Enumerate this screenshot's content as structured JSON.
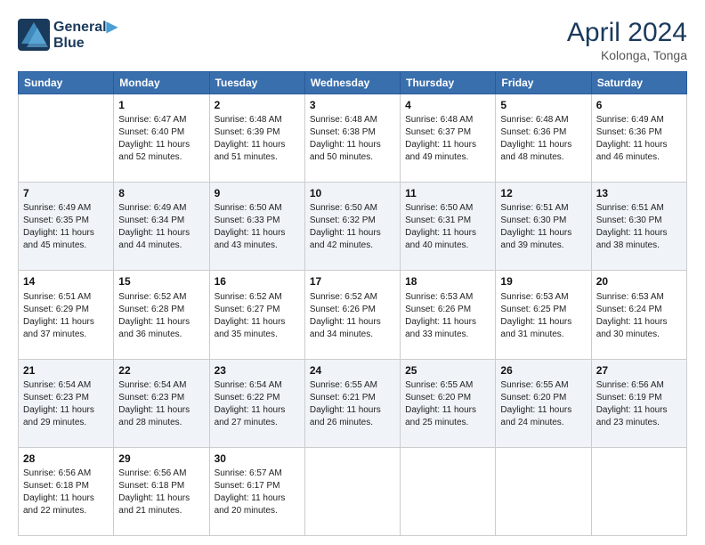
{
  "header": {
    "logo_line1": "General",
    "logo_line2": "Blue",
    "month_year": "April 2024",
    "location": "Kolonga, Tonga"
  },
  "weekdays": [
    "Sunday",
    "Monday",
    "Tuesday",
    "Wednesday",
    "Thursday",
    "Friday",
    "Saturday"
  ],
  "weeks": [
    [
      {
        "day": "",
        "info": ""
      },
      {
        "day": "1",
        "info": "Sunrise: 6:47 AM\nSunset: 6:40 PM\nDaylight: 11 hours\nand 52 minutes."
      },
      {
        "day": "2",
        "info": "Sunrise: 6:48 AM\nSunset: 6:39 PM\nDaylight: 11 hours\nand 51 minutes."
      },
      {
        "day": "3",
        "info": "Sunrise: 6:48 AM\nSunset: 6:38 PM\nDaylight: 11 hours\nand 50 minutes."
      },
      {
        "day": "4",
        "info": "Sunrise: 6:48 AM\nSunset: 6:37 PM\nDaylight: 11 hours\nand 49 minutes."
      },
      {
        "day": "5",
        "info": "Sunrise: 6:48 AM\nSunset: 6:36 PM\nDaylight: 11 hours\nand 48 minutes."
      },
      {
        "day": "6",
        "info": "Sunrise: 6:49 AM\nSunset: 6:36 PM\nDaylight: 11 hours\nand 46 minutes."
      }
    ],
    [
      {
        "day": "7",
        "info": "Sunrise: 6:49 AM\nSunset: 6:35 PM\nDaylight: 11 hours\nand 45 minutes."
      },
      {
        "day": "8",
        "info": "Sunrise: 6:49 AM\nSunset: 6:34 PM\nDaylight: 11 hours\nand 44 minutes."
      },
      {
        "day": "9",
        "info": "Sunrise: 6:50 AM\nSunset: 6:33 PM\nDaylight: 11 hours\nand 43 minutes."
      },
      {
        "day": "10",
        "info": "Sunrise: 6:50 AM\nSunset: 6:32 PM\nDaylight: 11 hours\nand 42 minutes."
      },
      {
        "day": "11",
        "info": "Sunrise: 6:50 AM\nSunset: 6:31 PM\nDaylight: 11 hours\nand 40 minutes."
      },
      {
        "day": "12",
        "info": "Sunrise: 6:51 AM\nSunset: 6:30 PM\nDaylight: 11 hours\nand 39 minutes."
      },
      {
        "day": "13",
        "info": "Sunrise: 6:51 AM\nSunset: 6:30 PM\nDaylight: 11 hours\nand 38 minutes."
      }
    ],
    [
      {
        "day": "14",
        "info": "Sunrise: 6:51 AM\nSunset: 6:29 PM\nDaylight: 11 hours\nand 37 minutes."
      },
      {
        "day": "15",
        "info": "Sunrise: 6:52 AM\nSunset: 6:28 PM\nDaylight: 11 hours\nand 36 minutes."
      },
      {
        "day": "16",
        "info": "Sunrise: 6:52 AM\nSunset: 6:27 PM\nDaylight: 11 hours\nand 35 minutes."
      },
      {
        "day": "17",
        "info": "Sunrise: 6:52 AM\nSunset: 6:26 PM\nDaylight: 11 hours\nand 34 minutes."
      },
      {
        "day": "18",
        "info": "Sunrise: 6:53 AM\nSunset: 6:26 PM\nDaylight: 11 hours\nand 33 minutes."
      },
      {
        "day": "19",
        "info": "Sunrise: 6:53 AM\nSunset: 6:25 PM\nDaylight: 11 hours\nand 31 minutes."
      },
      {
        "day": "20",
        "info": "Sunrise: 6:53 AM\nSunset: 6:24 PM\nDaylight: 11 hours\nand 30 minutes."
      }
    ],
    [
      {
        "day": "21",
        "info": "Sunrise: 6:54 AM\nSunset: 6:23 PM\nDaylight: 11 hours\nand 29 minutes."
      },
      {
        "day": "22",
        "info": "Sunrise: 6:54 AM\nSunset: 6:23 PM\nDaylight: 11 hours\nand 28 minutes."
      },
      {
        "day": "23",
        "info": "Sunrise: 6:54 AM\nSunset: 6:22 PM\nDaylight: 11 hours\nand 27 minutes."
      },
      {
        "day": "24",
        "info": "Sunrise: 6:55 AM\nSunset: 6:21 PM\nDaylight: 11 hours\nand 26 minutes."
      },
      {
        "day": "25",
        "info": "Sunrise: 6:55 AM\nSunset: 6:20 PM\nDaylight: 11 hours\nand 25 minutes."
      },
      {
        "day": "26",
        "info": "Sunrise: 6:55 AM\nSunset: 6:20 PM\nDaylight: 11 hours\nand 24 minutes."
      },
      {
        "day": "27",
        "info": "Sunrise: 6:56 AM\nSunset: 6:19 PM\nDaylight: 11 hours\nand 23 minutes."
      }
    ],
    [
      {
        "day": "28",
        "info": "Sunrise: 6:56 AM\nSunset: 6:18 PM\nDaylight: 11 hours\nand 22 minutes."
      },
      {
        "day": "29",
        "info": "Sunrise: 6:56 AM\nSunset: 6:18 PM\nDaylight: 11 hours\nand 21 minutes."
      },
      {
        "day": "30",
        "info": "Sunrise: 6:57 AM\nSunset: 6:17 PM\nDaylight: 11 hours\nand 20 minutes."
      },
      {
        "day": "",
        "info": ""
      },
      {
        "day": "",
        "info": ""
      },
      {
        "day": "",
        "info": ""
      },
      {
        "day": "",
        "info": ""
      }
    ]
  ]
}
